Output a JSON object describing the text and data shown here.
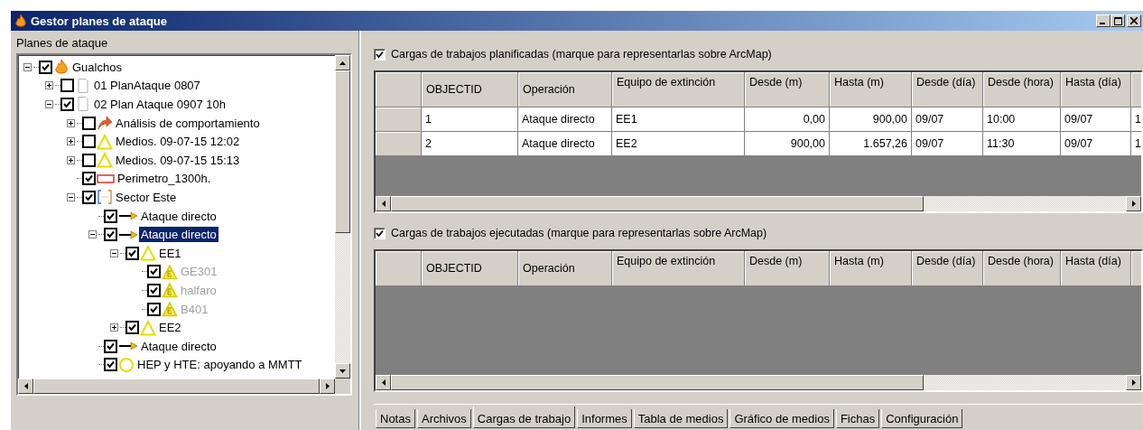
{
  "window": {
    "title": "Gestor planes de ataque"
  },
  "tree": {
    "label": "Planes de ataque",
    "items": [
      {
        "label": "Gualchos",
        "kind": "fire",
        "checked": true,
        "expanded": true,
        "selected": false,
        "disabled": false,
        "children": [
          {
            "label": "01 PlanAtaque 0807",
            "kind": "document",
            "checked": false,
            "expanded": false,
            "selected": false,
            "disabled": false
          },
          {
            "label": "02 Plan Ataque 0907 10h",
            "kind": "document",
            "checked": true,
            "expanded": true,
            "selected": false,
            "disabled": false,
            "children": [
              {
                "label": "Análisis de comportamiento",
                "kind": "behavior",
                "checked": false,
                "expanded": false,
                "selected": false,
                "disabled": false
              },
              {
                "label": "Medios. 09-07-15 12:02",
                "kind": "triangle",
                "checked": false,
                "expanded": false,
                "selected": false,
                "disabled": false
              },
              {
                "label": "Medios. 09-07-15 15:13",
                "kind": "triangle",
                "checked": false,
                "expanded": false,
                "selected": false,
                "disabled": false
              },
              {
                "label": "Perimetro_1300h.",
                "kind": "rectangle",
                "checked": true,
                "selected": false,
                "disabled": false
              },
              {
                "label": "Sector Este",
                "kind": "bracket",
                "checked": true,
                "expanded": true,
                "selected": false,
                "disabled": false,
                "children": [
                  {
                    "label": "Ataque directo",
                    "kind": "arrow",
                    "checked": true,
                    "selected": false,
                    "disabled": false
                  },
                  {
                    "label": "Ataque directo",
                    "kind": "arrow",
                    "checked": true,
                    "expanded": true,
                    "selected": true,
                    "disabled": false,
                    "children": [
                      {
                        "label": "EE1",
                        "kind": "triangle",
                        "checked": true,
                        "expanded": true,
                        "selected": false,
                        "disabled": false,
                        "children": [
                          {
                            "label": "GE301",
                            "kind": "vehicle",
                            "checked": true,
                            "selected": false,
                            "disabled": true
                          },
                          {
                            "label": "halfaro",
                            "kind": "vehicle",
                            "checked": true,
                            "selected": false,
                            "disabled": true
                          },
                          {
                            "label": "B401",
                            "kind": "vehicle",
                            "checked": true,
                            "selected": false,
                            "disabled": true
                          }
                        ]
                      },
                      {
                        "label": "EE2",
                        "kind": "triangle",
                        "checked": true,
                        "expanded": false,
                        "selected": false,
                        "disabled": false
                      }
                    ]
                  },
                  {
                    "label": "Ataque directo",
                    "kind": "arrow",
                    "checked": true,
                    "selected": false,
                    "disabled": false
                  },
                  {
                    "label": "HEP y HTE: apoyando a MMTT",
                    "kind": "circle",
                    "checked": true,
                    "selected": false,
                    "disabled": false
                  }
                ]
              }
            ]
          }
        ]
      }
    ]
  },
  "tables": [
    {
      "label": "Cargas de trabajos planificadas (marque para representarlas sobre ArcMap)",
      "checked": true,
      "columns": [
        "OBJECTID",
        "Operación",
        "Equipo de extinción",
        "Desde (m)",
        "Hasta (m)",
        "Desde (día)",
        "Desde (hora)",
        "Hasta (día)"
      ],
      "rows": [
        [
          "1",
          "Ataque directo",
          "EE1",
          "0,00",
          "900,00",
          "09/07",
          "10:00",
          "09/07",
          "1"
        ],
        [
          "2",
          "Ataque directo",
          "EE2",
          "900,00",
          "1.657,26",
          "09/07",
          "11:30",
          "09/07",
          "1"
        ]
      ]
    },
    {
      "label": "Cargas de trabajos ejecutadas (marque para representarlas sobre ArcMap)",
      "checked": true,
      "columns": [
        "OBJECTID",
        "Operación",
        "Equipo de extinción",
        "Desde (m)",
        "Hasta (m)",
        "Desde (día)",
        "Desde (hora)",
        "Hasta (día)"
      ]
    }
  ],
  "tabs": [
    {
      "label": "Notas",
      "selected": false
    },
    {
      "label": "Archivos",
      "selected": false
    },
    {
      "label": "Cargas de trabajo",
      "selected": true
    },
    {
      "label": "Informes",
      "selected": false
    },
    {
      "label": "Tabla de medios",
      "selected": false
    },
    {
      "label": "Gráfico de medios",
      "selected": false
    },
    {
      "label": "Fichas",
      "selected": false
    },
    {
      "label": "Configuración",
      "selected": false
    }
  ]
}
